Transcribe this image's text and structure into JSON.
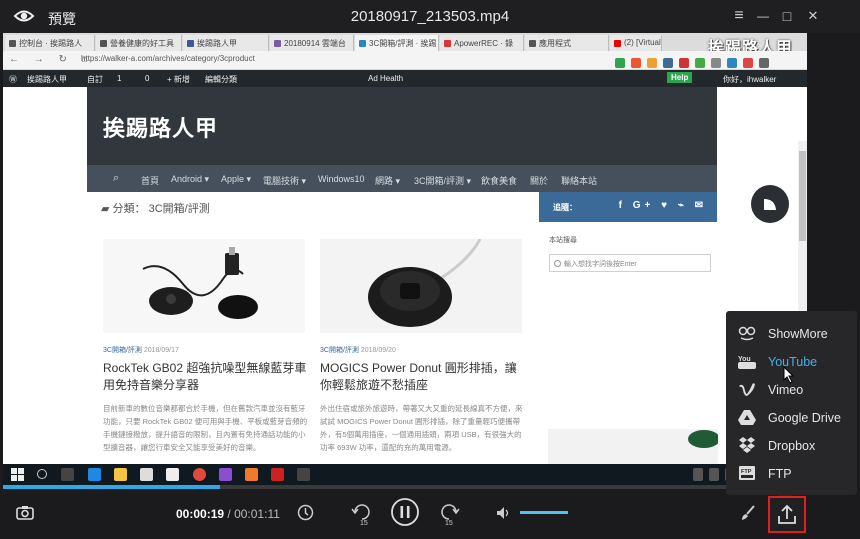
{
  "window": {
    "app_name": "預覽",
    "file_title": "20180917_213503.mp4",
    "buttons": {
      "menu": "≡",
      "minimize": "—",
      "maximize": "□",
      "close": "✕"
    }
  },
  "browser": {
    "tabs": [
      {
        "label": "控制台 · 挨踢路人",
        "color": "#555"
      },
      {
        "label": "營養健康的好工具",
        "color": "#555"
      },
      {
        "label": "挨踢路人甲",
        "color": "#3b5998"
      },
      {
        "label": "20180914 雲端台",
        "color": "#7a5ba8"
      },
      {
        "label": "3C開箱/評測 · 挨踢",
        "color": "#2e86c1"
      },
      {
        "label": "ApowerREC · 錄",
        "color": "#d33"
      },
      {
        "label": "應用程式",
        "color": "#555"
      },
      {
        "label": "(2) [Virtual",
        "color": "#e00"
      }
    ],
    "watermark": "挨踢路人甲",
    "url": "https://walker-a.com/archives/category/3cproduct",
    "nav_glyphs": "← → ↻ ⌂"
  },
  "wp_admin_bar": {
    "site": "挨踢路人甲",
    "custom": "自訂",
    "updates": "1",
    "comments": "0",
    "new": "+ 新增",
    "edit": "編輯分類",
    "plugin": "Ad Health",
    "help": "Help",
    "greeting": "你好，ihwalker"
  },
  "site": {
    "title": "挨踢路人甲",
    "nav": [
      "首頁",
      "Android ▾",
      "Apple ▾",
      "電腦技術 ▾",
      "Windows10",
      "網路 ▾",
      "3C開箱/評測 ▾",
      "飲食美食",
      "關於",
      "聯絡本站"
    ],
    "category_prefix": "分類：",
    "category": "3C開箱/評測",
    "sidebar_label": "追隨：",
    "socials": "f G+ ♥ ⌁ ✉",
    "search_label": "本站搜尋",
    "search_placeholder": "輸入想找字詞後按Enter",
    "posts": [
      {
        "category": "3C開箱/評測",
        "date": "2018/09/17",
        "title": "RockTek GB02 超強抗噪型無線藍芽車用免持音樂分享器",
        "excerpt": "目前新車的數位音樂都都合於手機，但在舊款汽車並沒有藍牙功能，只要 RockTek GB02 便可用與手機、平板或藍芽音頻的手機鏈接撥放，提升語音的限制，且內置有免持通話功能的小型擴音器，讓您行車安全又能享受美好的音樂。"
      },
      {
        "category": "3C開箱/評測",
        "date": "2018/09/20",
        "title": "MOGICS Power Donut 圓形排插，讓你輕鬆旅遊不愁插座",
        "excerpt": "外出住宿或旅外旅遊時，帶著又大又重的延長線真不方便，來試試 MOGICS Power Donut 圓形排插，除了重量輕巧便攜帶外，有5個萬用插座，一個通用插頭，兩項 USB，有很強大的功率 693W 功率，還配的充的萬用電源。"
      }
    ]
  },
  "player": {
    "current_time": "00:00:19",
    "separator": "/",
    "total_time": "00:01:11",
    "progress": 0.27,
    "volume": 0.75,
    "rewind_label": "15",
    "forward_label": "15"
  },
  "share_menu": {
    "items": [
      {
        "label": "ShowMore",
        "icon": "showmore-icon"
      },
      {
        "label": "YouTube",
        "icon": "youtube-icon"
      },
      {
        "label": "Vimeo",
        "icon": "vimeo-icon"
      },
      {
        "label": "Google Drive",
        "icon": "google-drive-icon"
      },
      {
        "label": "Dropbox",
        "icon": "dropbox-icon"
      },
      {
        "label": "FTP",
        "icon": "ftp-icon"
      }
    ],
    "highlighted": "YouTube"
  }
}
